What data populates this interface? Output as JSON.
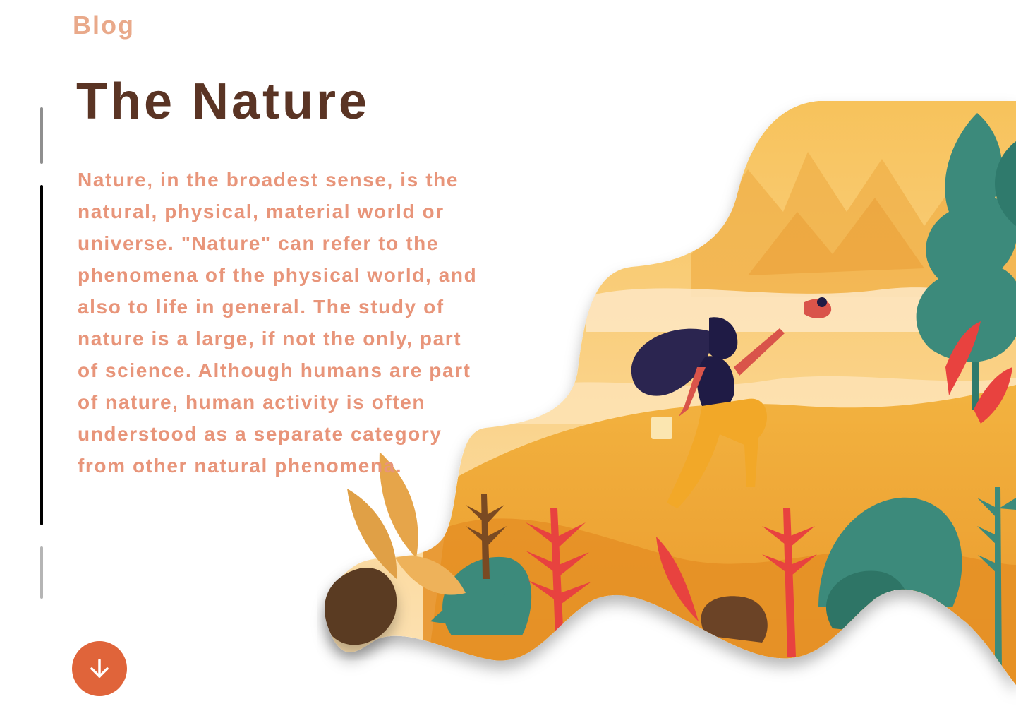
{
  "header": {
    "brand": "Blog"
  },
  "article": {
    "title": "The Nature",
    "body": "Nature, in the broadest sense, is the natural, physical, material world or universe. \"Nature\" can refer to the phenomena of the physical world, and also to life in general. The study of nature is a large, if not the only, part of science. Although humans are part of nature, human activity is often understood as a separate category from other natural phenomena."
  },
  "controls": {
    "scroll_icon": "arrow-down-icon"
  },
  "illustration": {
    "subject": "woman-hiking-hills-illustration"
  },
  "colors": {
    "brand": "#e9a98a",
    "title": "#5a3424",
    "body": "#e8957a",
    "accent": "#e0643a"
  }
}
